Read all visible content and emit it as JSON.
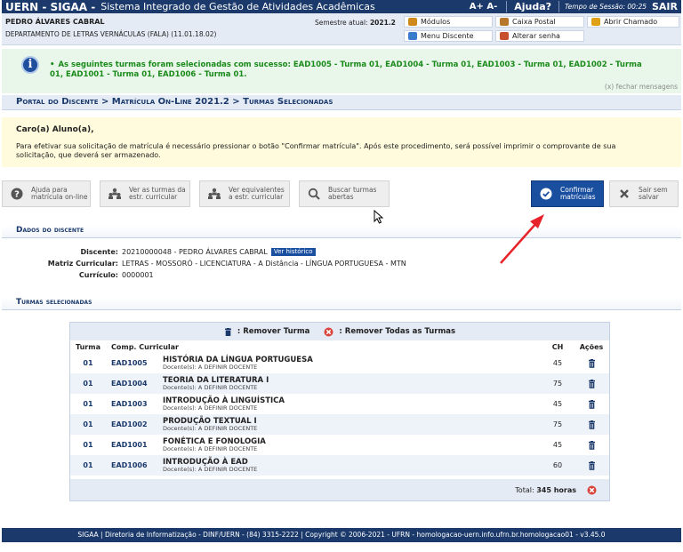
{
  "topbar": {
    "brand": "UERN - SIGAA -",
    "system_name": "Sistema Integrado de Gestão de Atividades Acadêmicas",
    "font_controls": "A+  A-",
    "help": "Ajuda?",
    "session": "Tempo de Sessão: 00:25",
    "logout": "SAIR"
  },
  "user": {
    "name": "PEDRO ÁLVARES CABRAL",
    "department": "DEPARTAMENTO DE LETRAS VERNÁCULAS (FALA) (11.01.18.02)",
    "semester_label": "Semestre atual:",
    "semester_value": "2021.2"
  },
  "shortcuts": {
    "modulos": "Módulos",
    "caixa_postal": "Caixa Postal",
    "abrir_chamado": "Abrir Chamado",
    "menu_discente": "Menu Discente",
    "alterar_senha": "Alterar senha"
  },
  "message": {
    "text": "As seguintes turmas foram selecionadas com sucesso: EAD1005 - Turma 01, EAD1004 - Turma 01, EAD1003 - Turma 01, EAD1002 - Turma 01, EAD1001 - Turma 01, EAD1006 - Turma 01.",
    "close": "(x) fechar mensagens"
  },
  "breadcrumb": "Portal do Discente > Matrícula On-Line 2021.2 > Turmas Selecionadas",
  "notice": {
    "greeting": "Caro(a) Aluno(a),",
    "body": "Para efetivar sua solicitação de matrícula é necessário pressionar o botão \"Confirmar matrícula\". Após este procedimento, será possível imprimir o comprovante de sua solicitação, que deverá ser armazenado."
  },
  "actions": {
    "help": "Ajuda para matrícula on-line",
    "view_curricular": "Ver as turmas da estr. curricular",
    "view_equivalents": "Ver equivalentes a estr. curricular",
    "search_open": "Buscar turmas abertas",
    "confirm": "Confirmar matrículas",
    "exit": "Sair sem salvar"
  },
  "student": {
    "section_title": "Dados do discente",
    "discente_label": "Discente:",
    "discente_value": "20210000048 - PEDRO ÁLVARES CABRAL",
    "history_badge": "Ver histórico",
    "matriz_label": "Matriz Curricular:",
    "matriz_value": "LETRAS - MOSSORÓ - LICENCIATURA - A Distância - LÍNGUA PORTUGUESA - MTN",
    "curriculo_label": "Currículo:",
    "curriculo_value": "0000001"
  },
  "classes": {
    "section_title": "Turmas selecionadas",
    "remove_one": ": Remover Turma",
    "remove_all": ": Remover Todas as Turmas",
    "columns": {
      "turma": "Turma",
      "comp": "Comp. Curricular",
      "ch": "CH",
      "acoes": "Ações"
    },
    "rows": [
      {
        "turma": "01",
        "code": "EAD1005",
        "name": "HISTÓRIA DA LÍNGUA PORTUGUESA",
        "docente": "Docente(s): A DEFINIR DOCENTE",
        "ch": "45"
      },
      {
        "turma": "01",
        "code": "EAD1004",
        "name": "TEORIA DA LITERATURA I",
        "docente": "Docente(s): A DEFINIR DOCENTE",
        "ch": "75"
      },
      {
        "turma": "01",
        "code": "EAD1003",
        "name": "INTRODUÇÃO À LINGUÍSTICA",
        "docente": "Docente(s): A DEFINIR DOCENTE",
        "ch": "45"
      },
      {
        "turma": "01",
        "code": "EAD1002",
        "name": "PRODUÇÃO TEXTUAL I",
        "docente": "Docente(s): A DEFINIR DOCENTE",
        "ch": "75"
      },
      {
        "turma": "01",
        "code": "EAD1001",
        "name": "FONÉTICA E FONOLOGIA",
        "docente": "Docente(s): A DEFINIR DOCENTE",
        "ch": "45"
      },
      {
        "turma": "01",
        "code": "EAD1006",
        "name": "INTRODUÇÃO À EAD",
        "docente": "Docente(s): A DEFINIR DOCENTE",
        "ch": "60"
      }
    ],
    "total_label": "Total:",
    "total_value": "345 horas"
  },
  "footer": "SIGAA | Diretoria de Informatização - DINF/UERN - (84) 3315-2222 | Copyright © 2006-2021 - UFRN - homologacao-uern.info.ufrn.br.homologacao01 - v3.45.0",
  "colors": {
    "navy": "#1b3a6b",
    "primary_button": "#1a4fa0",
    "success_text": "#1a8a1a",
    "arrow": "#e8222a"
  }
}
